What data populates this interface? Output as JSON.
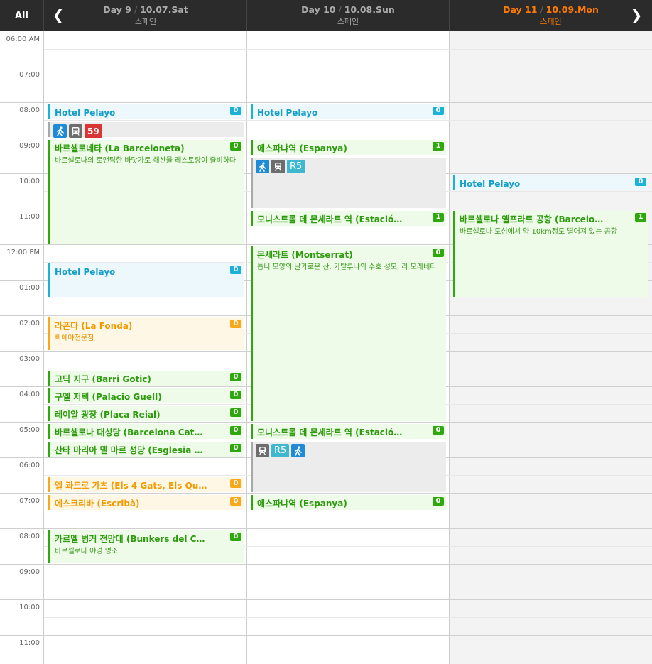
{
  "header": {
    "all_label": "All",
    "prev_icon": "chevron-left-icon",
    "next_icon": "chevron-right-icon",
    "days": [
      {
        "day": "Day 9",
        "date": "10.07.Sat",
        "country": "스페인",
        "today": false
      },
      {
        "day": "Day 10",
        "date": "10.08.Sun",
        "country": "스페인",
        "today": false
      },
      {
        "day": "Day 11",
        "date": "10.09.Mon",
        "country": "스페인",
        "today": true
      }
    ]
  },
  "time_labels": [
    "06:00 AM",
    "07:00",
    "08:00",
    "09:00",
    "10:00",
    "11:00",
    "12:00 PM",
    "01:00",
    "02:00",
    "03:00",
    "04:00",
    "05:00",
    "06:00",
    "07:00",
    "08:00",
    "09:00",
    "10:00",
    "11:00"
  ],
  "colors": {
    "green": "#2fa80d",
    "blue": "#1ab2d8",
    "orange": "#f7a81b",
    "gray": "#a8a8a8",
    "today": "#ff7a00"
  },
  "events": {
    "day9": [
      {
        "title": "Hotel Pelayo",
        "badge": "0",
        "color": "blue"
      },
      {
        "title": "바르셀로네타 (La Barceloneta)",
        "badge": "0",
        "color": "green",
        "desc": "바르셀로나의 로맨틱한 바닷가로 해산물 레스토랑이 즐비하다"
      },
      {
        "title": "Hotel Pelayo",
        "badge": "0",
        "color": "blue"
      },
      {
        "title": "라폰다 (La Fonda)",
        "badge": "0",
        "color": "orange",
        "desc": "빠에야전문점"
      },
      {
        "title": "고딕 지구 (Barri Gotic)",
        "badge": "0",
        "color": "green"
      },
      {
        "title": "구엘 저택 (Palacio Guell)",
        "badge": "0",
        "color": "green"
      },
      {
        "title": "레이알 광장 (Placa Reial)",
        "badge": "0",
        "color": "green"
      },
      {
        "title": "바르셀로나 대성당 (Barcelona Cat…",
        "badge": "0",
        "color": "green"
      },
      {
        "title": "산타 마리아 델 마르 성당 (Esglesia …",
        "badge": "0",
        "color": "green"
      },
      {
        "title": "엘 콰트로 가츠 (Els 4 Gats, Els Qu…",
        "badge": "0",
        "color": "orange"
      },
      {
        "title": "에스크리바 (Escribà)",
        "badge": "0",
        "color": "orange"
      },
      {
        "title": "카르멜 벙커 전망대 (Bunkers del C…",
        "badge": "0",
        "color": "green",
        "desc": "바르셀로나 야경 명소"
      }
    ],
    "day10": [
      {
        "title": "Hotel Pelayo",
        "badge": "0",
        "color": "blue"
      },
      {
        "title": "에스파냐역 (Espanya)",
        "badge": "1",
        "color": "green"
      },
      {
        "title": "모니스트롤 데 몬세라트 역 (Estació…",
        "badge": "1",
        "color": "green"
      },
      {
        "title": "몬세라트 (Montserrat)",
        "badge": "0",
        "color": "green",
        "desc": "톱니 모양의 날카로운 산. 카탈루냐의 수호 성모, 라 모레네타"
      },
      {
        "title": "모니스트롤 데 몬세라트 역 (Estació…",
        "badge": "0",
        "color": "green"
      },
      {
        "title": "에스파냐역 (Espanya)",
        "badge": "0",
        "color": "green"
      }
    ],
    "day11": [
      {
        "title": "Hotel Pelayo",
        "badge": "0",
        "color": "blue"
      },
      {
        "title": "바르셀로나 엘프라트 공항 (Barcelo…",
        "badge": "1",
        "color": "green",
        "desc": "바르셀로나 도심에서 약 10km정도 떨어져 있는 공항"
      }
    ]
  },
  "transit": {
    "day9_1": {
      "icons": [
        "walk-icon",
        "bus-icon"
      ],
      "route": "59"
    },
    "day10_1": {
      "icons": [
        "walk-icon",
        "train-icon"
      ],
      "route": "R5"
    },
    "day10_2": {
      "icons": [
        "train-icon"
      ],
      "route": "R5",
      "after": "walk-icon"
    }
  }
}
